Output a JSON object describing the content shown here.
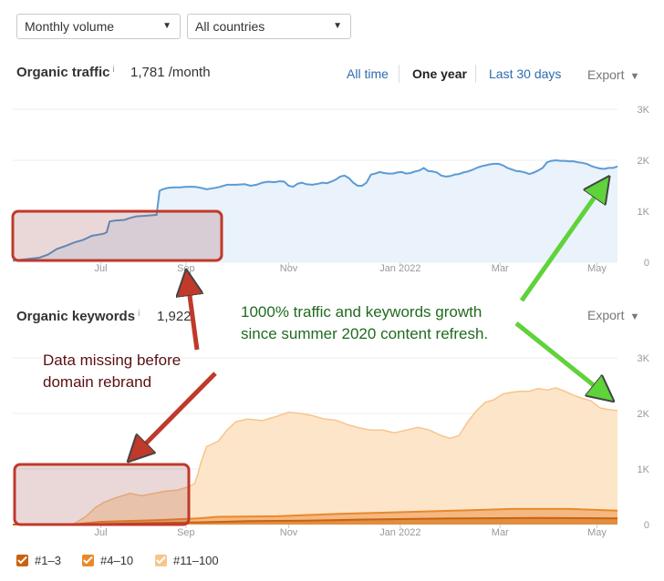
{
  "filters": {
    "volume": "Monthly volume",
    "countries": "All countries"
  },
  "traffic": {
    "title": "Organic traffic",
    "info": "i",
    "value": "1,781 /month",
    "ranges": [
      "All time",
      "One year",
      "Last 30 days"
    ],
    "export": "Export"
  },
  "keywords": {
    "title": "Organic keywords",
    "info": "i",
    "value": "1,922",
    "export": "Export"
  },
  "legend": [
    "#1–3",
    "#4–10",
    "#11–100"
  ],
  "annotations": {
    "growth": [
      "1000% traffic and keywords growth",
      "since summer 2020 content refresh."
    ],
    "missing": [
      "Data missing before",
      "domain rebrand"
    ]
  },
  "colors": {
    "traffic_line": "#5b9bd5",
    "traffic_fill": "#eaf2fb",
    "kw_top": "#f7c58c",
    "kw_top_fill": "#fde5c9",
    "kw_mid": "#e8892a",
    "kw_low": "#c9620f",
    "highlight": "#c0392b",
    "arrow_green": "#5fd33a",
    "arrow_red": "#c0392b",
    "growth_text": "#1f6b1f",
    "missing_text": "#5a1010",
    "link": "#2b6cb0"
  },
  "chart_data": [
    {
      "type": "line",
      "title": "Organic traffic",
      "ylim": [
        0,
        3000
      ],
      "yticks": [
        "3K",
        "2K",
        "1K",
        "0"
      ],
      "xticks": [
        "Jul",
        "Sep",
        "Nov",
        "Jan 2022",
        "Mar",
        "May"
      ],
      "series": [
        {
          "values": [
            [
              0,
              30
            ],
            [
              9,
              90
            ],
            [
              12,
              150
            ],
            [
              15,
              260
            ],
            [
              18,
              320
            ],
            [
              21,
              390
            ],
            [
              24,
              440
            ],
            [
              27,
              520
            ],
            [
              29,
              540
            ],
            [
              31,
              560
            ],
            [
              32,
              590
            ],
            [
              33,
              800
            ],
            [
              35,
              820
            ],
            [
              38,
              830
            ],
            [
              40,
              870
            ],
            [
              42,
              900
            ],
            [
              45,
              910
            ],
            [
              47,
              920
            ],
            [
              49,
              930
            ],
            [
              50,
              1400
            ],
            [
              50.6,
              1420
            ],
            [
              51.5,
              1440
            ],
            [
              53,
              1460
            ],
            [
              55,
              1470
            ],
            [
              57,
              1470
            ],
            [
              59,
              1480
            ],
            [
              60,
              1480
            ],
            [
              62,
              1480
            ],
            [
              64,
              1460
            ],
            [
              66,
              1430
            ],
            [
              68,
              1450
            ],
            [
              70,
              1470
            ],
            [
              73,
              1520
            ],
            [
              76,
              1520
            ],
            [
              79,
              1530
            ],
            [
              81,
              1500
            ],
            [
              83,
              1520
            ],
            [
              85,
              1560
            ],
            [
              87,
              1580
            ],
            [
              89,
              1570
            ],
            [
              91,
              1590
            ],
            [
              92.5,
              1580
            ],
            [
              94,
              1500
            ],
            [
              95.5,
              1480
            ],
            [
              97,
              1540
            ],
            [
              98.5,
              1560
            ],
            [
              100,
              1530
            ],
            [
              102,
              1520
            ],
            [
              104,
              1540
            ],
            [
              105.5,
              1560
            ],
            [
              107,
              1550
            ],
            [
              108.5,
              1580
            ],
            [
              110,
              1620
            ],
            [
              111.5,
              1680
            ],
            [
              113,
              1700
            ],
            [
              114.5,
              1650
            ],
            [
              116,
              1560
            ],
            [
              117.5,
              1500
            ],
            [
              119,
              1500
            ],
            [
              120.5,
              1560
            ],
            [
              122,
              1720
            ],
            [
              123.5,
              1740
            ],
            [
              125,
              1770
            ],
            [
              126.5,
              1750
            ],
            [
              128,
              1740
            ],
            [
              129.5,
              1740
            ],
            [
              131,
              1760
            ],
            [
              132.5,
              1770
            ],
            [
              134,
              1740
            ],
            [
              135.5,
              1750
            ],
            [
              137,
              1780
            ],
            [
              138.5,
              1800
            ],
            [
              140,
              1850
            ],
            [
              141.5,
              1790
            ],
            [
              143,
              1780
            ],
            [
              144.5,
              1760
            ],
            [
              146,
              1700
            ],
            [
              147.5,
              1680
            ],
            [
              149,
              1690
            ],
            [
              150.5,
              1720
            ],
            [
              152,
              1730
            ],
            [
              153.5,
              1760
            ],
            [
              155,
              1780
            ],
            [
              156.5,
              1810
            ],
            [
              158,
              1850
            ],
            [
              159.5,
              1880
            ],
            [
              161,
              1900
            ],
            [
              162.5,
              1920
            ],
            [
              164,
              1930
            ],
            [
              165.5,
              1930
            ],
            [
              167,
              1900
            ],
            [
              168.5,
              1850
            ],
            [
              170,
              1820
            ],
            [
              171.5,
              1790
            ],
            [
              173,
              1780
            ],
            [
              174.5,
              1760
            ],
            [
              176,
              1730
            ],
            [
              177.5,
              1760
            ],
            [
              179,
              1800
            ],
            [
              180.5,
              1850
            ],
            [
              182,
              1960
            ],
            [
              183.5,
              1990
            ],
            [
              185,
              2000
            ],
            [
              186.5,
              1990
            ],
            [
              188,
              1990
            ],
            [
              189.5,
              1980
            ],
            [
              191,
              1980
            ],
            [
              192.5,
              1960
            ],
            [
              194,
              1950
            ],
            [
              195.5,
              1930
            ],
            [
              197,
              1890
            ],
            [
              198.5,
              1860
            ],
            [
              200,
              1840
            ],
            [
              201.5,
              1830
            ],
            [
              203,
              1850
            ],
            [
              204.5,
              1850
            ],
            [
              206,
              1880
            ]
          ]
        }
      ]
    },
    {
      "type": "area",
      "title": "Organic keywords",
      "ylim": [
        0,
        3000
      ],
      "yticks": [
        "3K",
        "2K",
        "1K",
        "0"
      ],
      "xticks": [
        "Jul",
        "Sep",
        "Nov",
        "Jan 2022",
        "Mar",
        "May"
      ],
      "series": [
        {
          "name": "#11–100",
          "values": [
            [
              0,
              0
            ],
            [
              20,
              0
            ],
            [
              22,
              50
            ],
            [
              25,
              150
            ],
            [
              28,
              300
            ],
            [
              31,
              400
            ],
            [
              35,
              480
            ],
            [
              40,
              560
            ],
            [
              44,
              520
            ],
            [
              48,
              560
            ],
            [
              52,
              600
            ],
            [
              56,
              620
            ],
            [
              60,
              680
            ],
            [
              62,
              740
            ],
            [
              63,
              900
            ],
            [
              64,
              1100
            ],
            [
              66,
              1400
            ],
            [
              70,
              1500
            ],
            [
              73,
              1700
            ],
            [
              76,
              1850
            ],
            [
              80,
              1900
            ],
            [
              85,
              1870
            ],
            [
              90,
              1950
            ],
            [
              94,
              2020
            ],
            [
              98,
              2000
            ],
            [
              102,
              1960
            ],
            [
              106,
              1900
            ],
            [
              110,
              1880
            ],
            [
              114,
              1800
            ],
            [
              118,
              1740
            ],
            [
              122,
              1700
            ],
            [
              126,
              1700
            ],
            [
              130,
              1650
            ],
            [
              134,
              1700
            ],
            [
              138,
              1750
            ],
            [
              142,
              1700
            ],
            [
              146,
              1600
            ],
            [
              149,
              1550
            ],
            [
              152,
              1600
            ],
            [
              155,
              1850
            ],
            [
              158,
              2050
            ],
            [
              161,
              2200
            ],
            [
              164,
              2250
            ],
            [
              167,
              2350
            ],
            [
              170,
              2380
            ],
            [
              173,
              2400
            ],
            [
              176,
              2400
            ],
            [
              179,
              2450
            ],
            [
              182,
              2420
            ],
            [
              185,
              2460
            ],
            [
              188,
              2400
            ],
            [
              191,
              2330
            ],
            [
              194,
              2270
            ],
            [
              197,
              2230
            ],
            [
              200,
              2100
            ],
            [
              203,
              2070
            ],
            [
              206,
              2050
            ]
          ]
        },
        {
          "name": "#4–10",
          "values": [
            [
              0,
              0
            ],
            [
              20,
              0
            ],
            [
              30,
              50
            ],
            [
              50,
              80
            ],
            [
              63,
              110
            ],
            [
              70,
              140
            ],
            [
              90,
              150
            ],
            [
              110,
              190
            ],
            [
              130,
              220
            ],
            [
              150,
              250
            ],
            [
              170,
              280
            ],
            [
              190,
              280
            ],
            [
              206,
              250
            ]
          ]
        },
        {
          "name": "#1–3",
          "values": [
            [
              0,
              0
            ],
            [
              20,
              0
            ],
            [
              40,
              20
            ],
            [
              63,
              40
            ],
            [
              80,
              60
            ],
            [
              100,
              70
            ],
            [
              120,
              90
            ],
            [
              150,
              110
            ],
            [
              180,
              120
            ],
            [
              206,
              110
            ]
          ]
        }
      ]
    }
  ]
}
